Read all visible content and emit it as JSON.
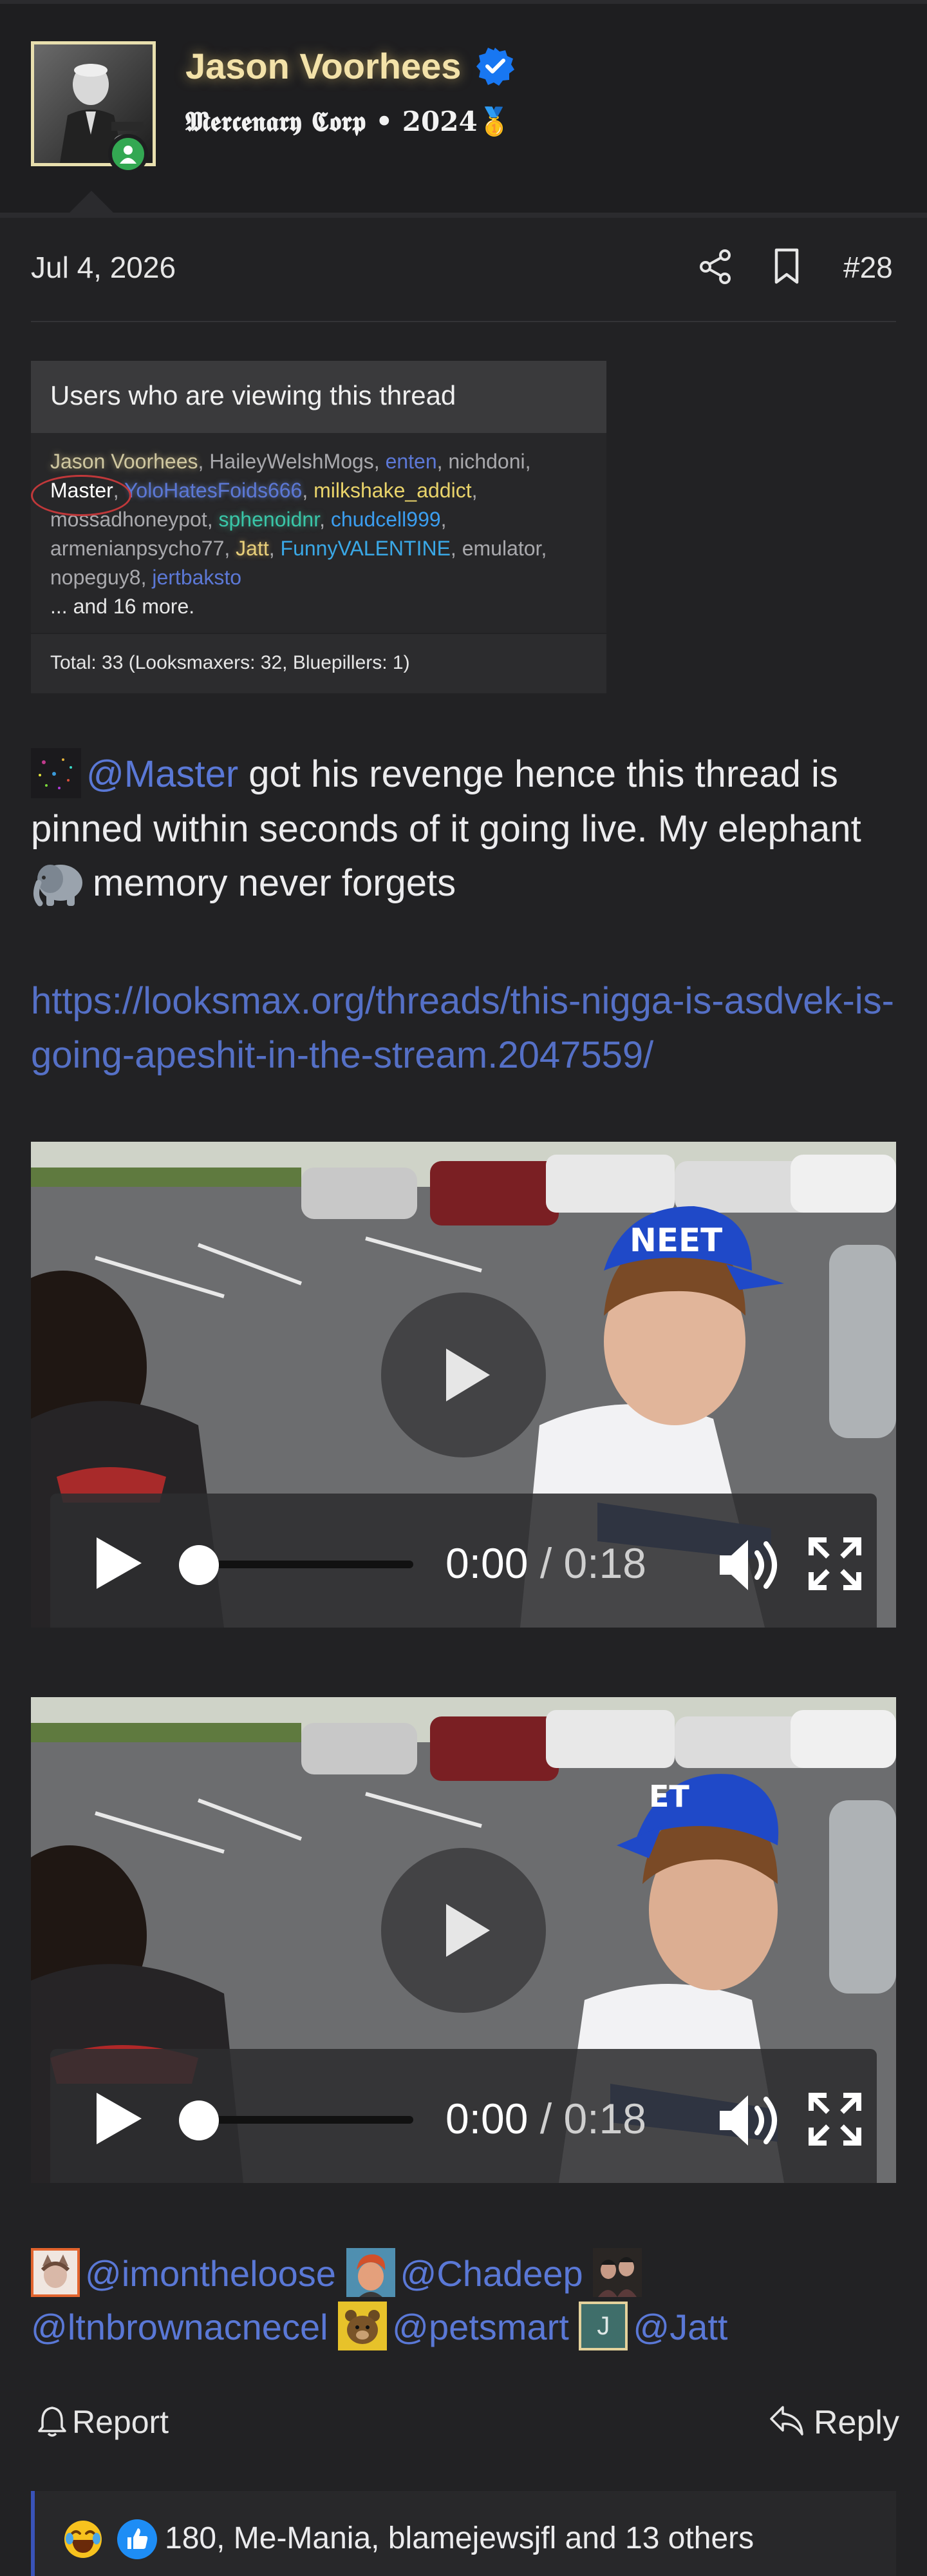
{
  "author": {
    "name": "Jason Voorhees",
    "title": "𝕸𝖊𝖗𝖈𝖊𝖓𝖆𝖗𝖞 𝕮𝖔𝖗𝖕 • 2024🥇",
    "verified": true,
    "online": true
  },
  "post": {
    "date": "Jul 4, 2026",
    "number": "#28"
  },
  "viewers": {
    "title": "Users who are viewing this thread",
    "names": {
      "jason": "Jason Voorhees",
      "hailey": "HaileyWelshMogs",
      "enten": "enten",
      "nichdoni": "nichdoni",
      "master": "Master",
      "yolo": "YoloHatesFoids666",
      "milkshake": "milkshake_addict",
      "mossad": "mossadhoneypot",
      "sphenoidnr": "sphenoidnr",
      "chudcell": "chudcell999",
      "armenian": "armenianpsycho77",
      "jatt": "Jatt",
      "funny": "FunnyVALENTINE",
      "emulator": "emulator",
      "nopeguy": "nopeguy8",
      "jertbaksto": "jertbaksto"
    },
    "more": "... and 16 more.",
    "total": "Total: 33 (Looksmaxers: 32, Bluepillers: 1)"
  },
  "body": {
    "mention": "@Master",
    "text_1": " got his revenge hence this thread is pinned within seconds of it going live. My elephant ",
    "text_2": "memory never forgets",
    "link": "https://looksmax.org/threads/this-nigga-is-asdvek-is-going-apeshit-in-the-stream.2047559/"
  },
  "videos": [
    {
      "current": "0:00",
      "separator": "/",
      "duration": "0:18",
      "progress": 0
    },
    {
      "current": "0:00",
      "separator": "/",
      "duration": "0:18",
      "progress": 0
    }
  ],
  "tags": {
    "user_1": "@imontheloose",
    "user_2": "@Chadeep",
    "user_3": "@ltnbrownacnecel",
    "user_4": "@petsmart",
    "user_5": "@Jatt",
    "user_5_initial": "J"
  },
  "actions": {
    "report": "Report",
    "reply": "Reply"
  },
  "reactions": {
    "summary": "180, Me-Mania, blamejewsjfl and 13 others"
  },
  "colors": {
    "accent_link": "#5570c6",
    "online": "#33a852",
    "reaction_border": "#3953b8"
  }
}
